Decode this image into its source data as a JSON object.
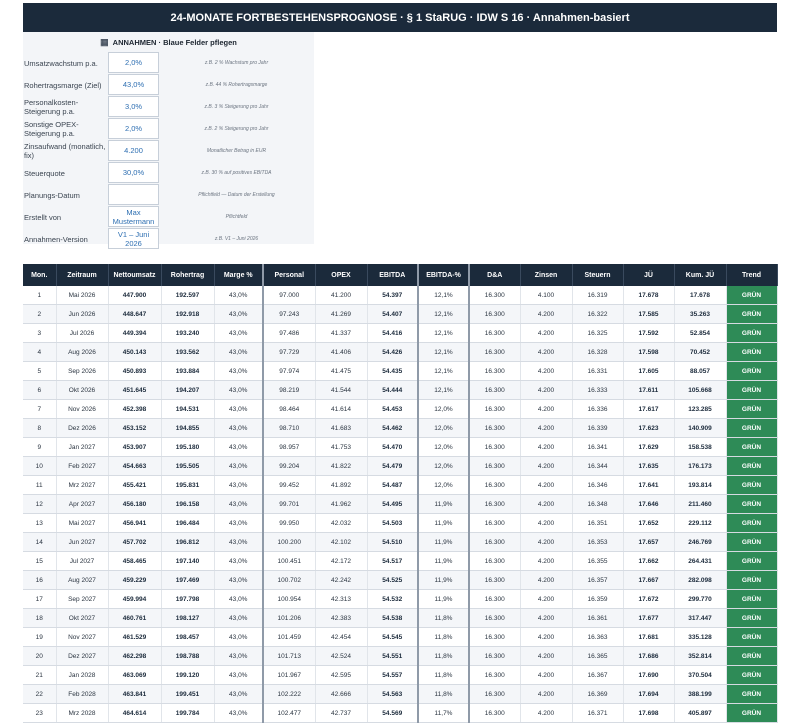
{
  "banner": "24-MONATE FORTBESTEHENSPROGNOSE  ·  § 1 StaRUG  ·  IDW S 16  ·  Annahmen-basiert",
  "assumptions": {
    "header_icon": "grid-icon",
    "header": "ANNAHMEN  ·  Blaue Felder pflegen",
    "rows": [
      {
        "label": "Umsatzwachstum p.a.",
        "value": "2,0%",
        "note": "z.B. 2 % Wachstum pro Jahr"
      },
      {
        "label": "Rohertragsmarge (Ziel)",
        "value": "43,0%",
        "note": "z.B. 44 % Rohertragsmarge"
      },
      {
        "label": "Personalkosten-Steigerung p.a.",
        "value": "3,0%",
        "note": "z.B. 3 % Steigerung pro Jahr"
      },
      {
        "label": "Sonstige OPEX-Steigerung p.a.",
        "value": "2,0%",
        "note": "z.B. 2 % Steigerung pro Jahr"
      },
      {
        "label": "Zinsaufwand (monatlich, fix)",
        "value": "4.200",
        "note": "Monatlicher Betrag in EUR"
      },
      {
        "label": "Steuerquote",
        "value": "30,0%",
        "note": "z.B. 30 % auf positives EBITDA"
      },
      {
        "label": "Planungs-Datum",
        "value": "",
        "note": "Pflichtfeld — Datum der Erstellung"
      },
      {
        "label": "Erstellt von",
        "value": "Max Mustermann",
        "note": "Pflichtfeld"
      },
      {
        "label": "Annahmen-Version",
        "value": "V1 – Juni 2026",
        "note": "z.B. V1 – Juni 2026"
      }
    ]
  },
  "table": {
    "headers": [
      "Mon.",
      "Zeitraum",
      "Nettoumsatz",
      "Rohertrag",
      "Marge %",
      "Personal",
      "OPEX",
      "EBITDA",
      "EBITDA-%",
      "D&A",
      "Zinsen",
      "Steuern",
      "JÜ",
      "Kum. JÜ",
      "Trend"
    ],
    "rows": [
      [
        "1",
        "Mai 2026",
        "447.900",
        "192.597",
        "43,0%",
        "97.000",
        "41.200",
        "54.397",
        "12,1%",
        "16.300",
        "4.100",
        "16.319",
        "17.678",
        "17.678",
        "GRÜN"
      ],
      [
        "2",
        "Jun 2026",
        "448.647",
        "192.918",
        "43,0%",
        "97.243",
        "41.269",
        "54.407",
        "12,1%",
        "16.300",
        "4.200",
        "16.322",
        "17.585",
        "35.263",
        "GRÜN"
      ],
      [
        "3",
        "Jul 2026",
        "449.394",
        "193.240",
        "43,0%",
        "97.486",
        "41.337",
        "54.416",
        "12,1%",
        "16.300",
        "4.200",
        "16.325",
        "17.592",
        "52.854",
        "GRÜN"
      ],
      [
        "4",
        "Aug 2026",
        "450.143",
        "193.562",
        "43,0%",
        "97.729",
        "41.406",
        "54.426",
        "12,1%",
        "16.300",
        "4.200",
        "16.328",
        "17.598",
        "70.452",
        "GRÜN"
      ],
      [
        "5",
        "Sep 2026",
        "450.893",
        "193.884",
        "43,0%",
        "97.974",
        "41.475",
        "54.435",
        "12,1%",
        "16.300",
        "4.200",
        "16.331",
        "17.605",
        "88.057",
        "GRÜN"
      ],
      [
        "6",
        "Okt 2026",
        "451.645",
        "194.207",
        "43,0%",
        "98.219",
        "41.544",
        "54.444",
        "12,1%",
        "16.300",
        "4.200",
        "16.333",
        "17.611",
        "105.668",
        "GRÜN"
      ],
      [
        "7",
        "Nov 2026",
        "452.398",
        "194.531",
        "43,0%",
        "98.464",
        "41.614",
        "54.453",
        "12,0%",
        "16.300",
        "4.200",
        "16.336",
        "17.617",
        "123.285",
        "GRÜN"
      ],
      [
        "8",
        "Dez 2026",
        "453.152",
        "194.855",
        "43,0%",
        "98.710",
        "41.683",
        "54.462",
        "12,0%",
        "16.300",
        "4.200",
        "16.339",
        "17.623",
        "140.909",
        "GRÜN"
      ],
      [
        "9",
        "Jan 2027",
        "453.907",
        "195.180",
        "43,0%",
        "98.957",
        "41.753",
        "54.470",
        "12,0%",
        "16.300",
        "4.200",
        "16.341",
        "17.629",
        "158.538",
        "GRÜN"
      ],
      [
        "10",
        "Feb 2027",
        "454.663",
        "195.505",
        "43,0%",
        "99.204",
        "41.822",
        "54.479",
        "12,0%",
        "16.300",
        "4.200",
        "16.344",
        "17.635",
        "176.173",
        "GRÜN"
      ],
      [
        "11",
        "Mrz 2027",
        "455.421",
        "195.831",
        "43,0%",
        "99.452",
        "41.892",
        "54.487",
        "12,0%",
        "16.300",
        "4.200",
        "16.346",
        "17.641",
        "193.814",
        "GRÜN"
      ],
      [
        "12",
        "Apr 2027",
        "456.180",
        "196.158",
        "43,0%",
        "99.701",
        "41.962",
        "54.495",
        "11,9%",
        "16.300",
        "4.200",
        "16.348",
        "17.646",
        "211.460",
        "GRÜN"
      ],
      [
        "13",
        "Mai 2027",
        "456.941",
        "196.484",
        "43,0%",
        "99.950",
        "42.032",
        "54.503",
        "11,9%",
        "16.300",
        "4.200",
        "16.351",
        "17.652",
        "229.112",
        "GRÜN"
      ],
      [
        "14",
        "Jun 2027",
        "457.702",
        "196.812",
        "43,0%",
        "100.200",
        "42.102",
        "54.510",
        "11,9%",
        "16.300",
        "4.200",
        "16.353",
        "17.657",
        "246.769",
        "GRÜN"
      ],
      [
        "15",
        "Jul 2027",
        "458.465",
        "197.140",
        "43,0%",
        "100.451",
        "42.172",
        "54.517",
        "11,9%",
        "16.300",
        "4.200",
        "16.355",
        "17.662",
        "264.431",
        "GRÜN"
      ],
      [
        "16",
        "Aug 2027",
        "459.229",
        "197.469",
        "43,0%",
        "100.702",
        "42.242",
        "54.525",
        "11,9%",
        "16.300",
        "4.200",
        "16.357",
        "17.667",
        "282.098",
        "GRÜN"
      ],
      [
        "17",
        "Sep 2027",
        "459.994",
        "197.798",
        "43,0%",
        "100.954",
        "42.313",
        "54.532",
        "11,9%",
        "16.300",
        "4.200",
        "16.359",
        "17.672",
        "299.770",
        "GRÜN"
      ],
      [
        "18",
        "Okt 2027",
        "460.761",
        "198.127",
        "43,0%",
        "101.206",
        "42.383",
        "54.538",
        "11,8%",
        "16.300",
        "4.200",
        "16.361",
        "17.677",
        "317.447",
        "GRÜN"
      ],
      [
        "19",
        "Nov 2027",
        "461.529",
        "198.457",
        "43,0%",
        "101.459",
        "42.454",
        "54.545",
        "11,8%",
        "16.300",
        "4.200",
        "16.363",
        "17.681",
        "335.128",
        "GRÜN"
      ],
      [
        "20",
        "Dez 2027",
        "462.298",
        "198.788",
        "43,0%",
        "101.713",
        "42.524",
        "54.551",
        "11,8%",
        "16.300",
        "4.200",
        "16.365",
        "17.686",
        "352.814",
        "GRÜN"
      ],
      [
        "21",
        "Jan 2028",
        "463.069",
        "199.120",
        "43,0%",
        "101.967",
        "42.595",
        "54.557",
        "11,8%",
        "16.300",
        "4.200",
        "16.367",
        "17.690",
        "370.504",
        "GRÜN"
      ],
      [
        "22",
        "Feb 2028",
        "463.841",
        "199.451",
        "43,0%",
        "102.222",
        "42.666",
        "54.563",
        "11,8%",
        "16.300",
        "4.200",
        "16.369",
        "17.694",
        "388.199",
        "GRÜN"
      ],
      [
        "23",
        "Mrz 2028",
        "464.614",
        "199.784",
        "43,0%",
        "102.477",
        "42.737",
        "54.569",
        "11,7%",
        "16.300",
        "4.200",
        "16.371",
        "17.698",
        "405.897",
        "GRÜN"
      ]
    ]
  },
  "colors": {
    "header_bg": "#1b2a3b",
    "trend_green": "#2e8b57",
    "input_text": "#2e6fb2"
  }
}
